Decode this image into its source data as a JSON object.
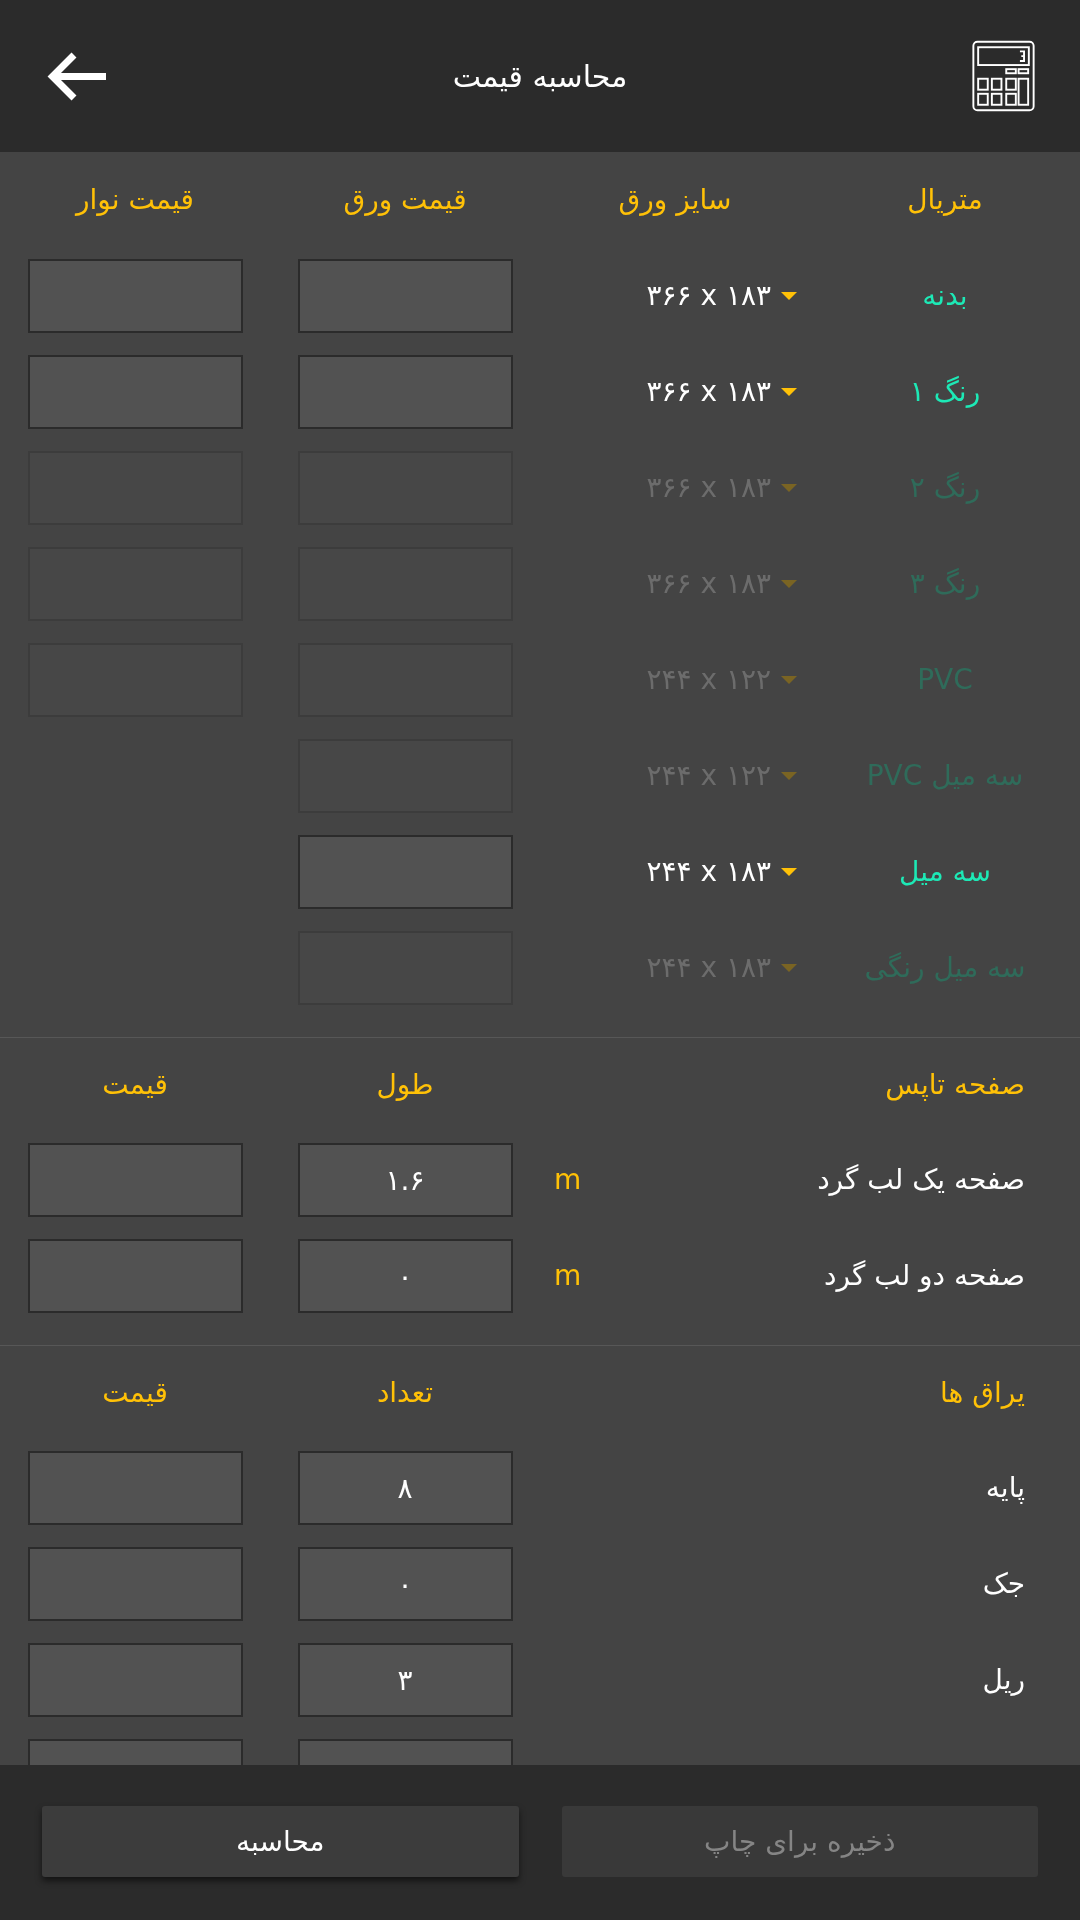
{
  "header": {
    "title": "محاسبه قیمت"
  },
  "materials": {
    "columns": [
      "متریال",
      "سایز ورق",
      "قیمت ورق",
      "قیمت نوار"
    ],
    "rows": [
      {
        "name": "بدنه",
        "size": "۳۶۶ x ۱۸۳",
        "disabled": false,
        "has_tape_price": true
      },
      {
        "name": "رنگ ۱",
        "size": "۳۶۶ x ۱۸۳",
        "disabled": false,
        "has_tape_price": true
      },
      {
        "name": "رنگ ۲",
        "size": "۳۶۶ x ۱۸۳",
        "disabled": true,
        "has_tape_price": true
      },
      {
        "name": "رنگ ۳",
        "size": "۳۶۶ x ۱۸۳",
        "disabled": true,
        "has_tape_price": true
      },
      {
        "name": "PVC",
        "size": "۲۴۴ x ۱۲۲",
        "disabled": true,
        "has_tape_price": true
      },
      {
        "name": "سه میل PVC",
        "size": "۲۴۴ x ۱۲۲",
        "disabled": true,
        "has_tape_price": false
      },
      {
        "name": "سه میل",
        "size": "۲۴۴ x ۱۸۳",
        "disabled": false,
        "has_tape_price": false
      },
      {
        "name": "سه میل رنگی",
        "size": "۲۴۴ x ۱۸۳",
        "disabled": true,
        "has_tape_price": false
      }
    ]
  },
  "tops": {
    "title": "صفحه تاپس",
    "columns": [
      "طول",
      "قیمت"
    ],
    "rows": [
      {
        "name": "صفحه یک لب گرد",
        "unit": "m",
        "length": "۱.۶"
      },
      {
        "name": "صفحه دو لب گرد",
        "unit": "m",
        "length": "۰"
      }
    ]
  },
  "hardware": {
    "title": "یراق ها",
    "columns": [
      "تعداد",
      "قیمت"
    ],
    "rows": [
      {
        "kind": "item",
        "name": "پایه",
        "count": "۸"
      },
      {
        "kind": "item",
        "name": "جک",
        "count": "۰"
      },
      {
        "kind": "item",
        "name": "ریل",
        "count": "۳"
      },
      {
        "kind": "clipped"
      }
    ]
  },
  "buttons": [
    {
      "label": "ذخیره برای چاپ",
      "disabled": true
    },
    {
      "label": "محاسبه",
      "disabled": false
    }
  ]
}
